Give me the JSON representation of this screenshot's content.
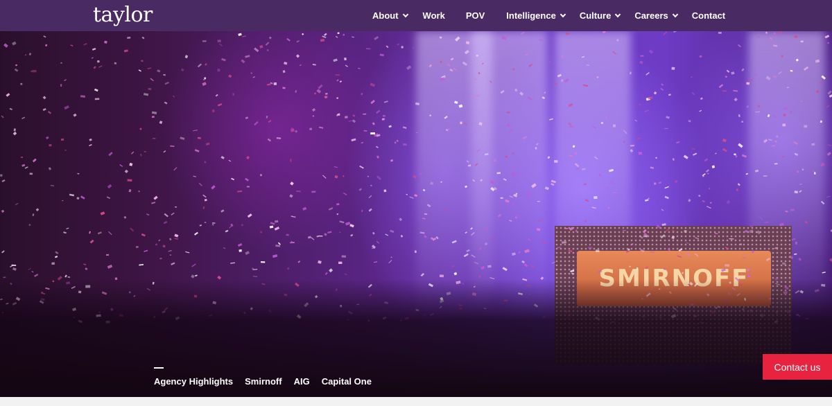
{
  "brand": {
    "logo_text": "taylor",
    "nav_color": "#4a2a63",
    "accent": "#e8233f"
  },
  "nav": {
    "items": [
      {
        "label": "About",
        "has_dropdown": true
      },
      {
        "label": "Work",
        "has_dropdown": false
      },
      {
        "label": "POV",
        "has_dropdown": false
      },
      {
        "label": "Intelligence",
        "has_dropdown": true
      },
      {
        "label": "Culture",
        "has_dropdown": true
      },
      {
        "label": "Careers",
        "has_dropdown": true
      },
      {
        "label": "Contact",
        "has_dropdown": false
      }
    ]
  },
  "hero": {
    "screen_text": "SMIRNOFF",
    "tabs": [
      {
        "label": "Agency Highlights",
        "active": true
      },
      {
        "label": "Smirnoff",
        "active": false
      },
      {
        "label": "AIG",
        "active": false
      },
      {
        "label": "Capital One",
        "active": false
      }
    ]
  },
  "cta": {
    "label": "Contact us"
  }
}
